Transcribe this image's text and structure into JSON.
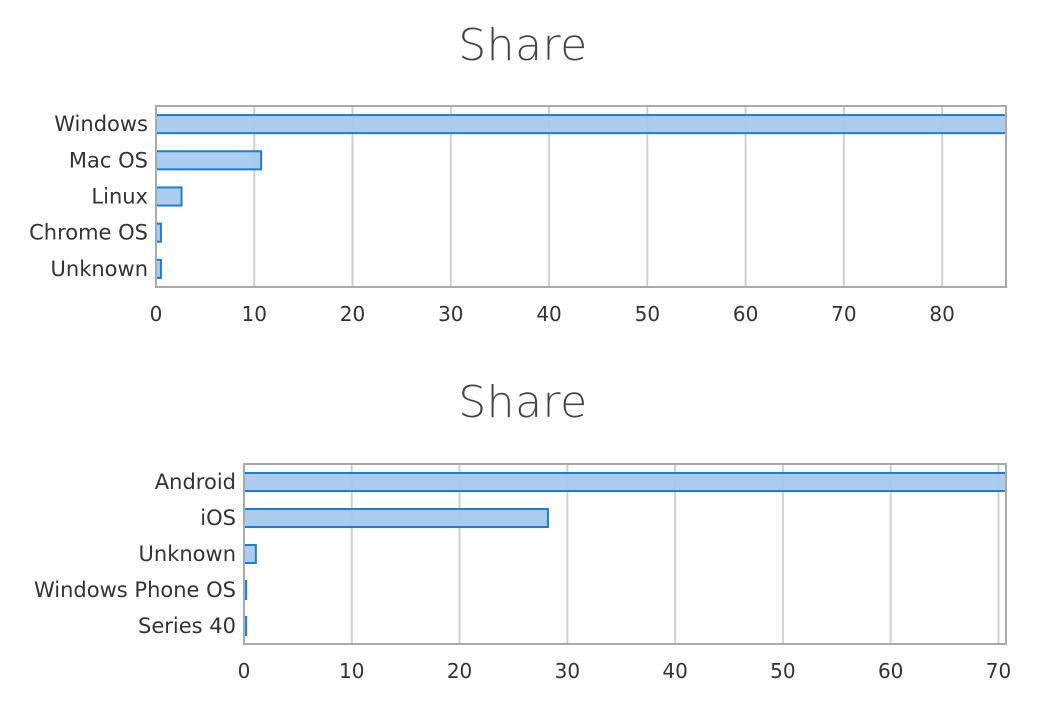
{
  "chart_data": [
    {
      "type": "bar",
      "orientation": "horizontal",
      "title": "Share",
      "categories": [
        "Windows",
        "Mac OS",
        "Linux",
        "Chrome OS",
        "Unknown"
      ],
      "values": [
        86.5,
        10.7,
        2.6,
        0.5,
        0.5
      ],
      "xlabel": "",
      "ylabel": "",
      "xlim": [
        0,
        86.5
      ],
      "xticks": [
        0,
        10,
        20,
        30,
        40,
        50,
        60,
        70,
        80
      ],
      "grid": true,
      "colors": {
        "fill": "#a6c9ec",
        "stroke": "#1a7fd4"
      }
    },
    {
      "type": "bar",
      "orientation": "horizontal",
      "title": "Share",
      "categories": [
        "Android",
        "iOS",
        "Unknown",
        "Windows Phone OS",
        "Series 40"
      ],
      "values": [
        70.7,
        28.2,
        1.1,
        0.2,
        0.2
      ],
      "xlabel": "",
      "ylabel": "",
      "xlim": [
        0,
        70.7
      ],
      "xticks": [
        0,
        10,
        20,
        30,
        40,
        50,
        60,
        70
      ],
      "grid": true,
      "colors": {
        "fill": "#a6c9ec",
        "stroke": "#1a7fd4"
      }
    }
  ]
}
